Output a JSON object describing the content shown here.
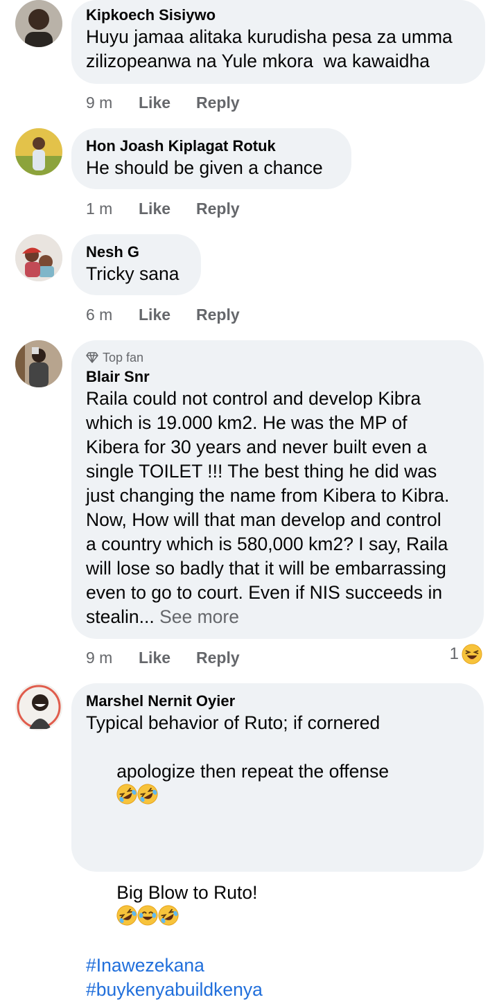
{
  "colors": {
    "bubble": "#eff2f5",
    "meta": "#65676b",
    "link": "#216fdb"
  },
  "comments": [
    {
      "name": "Kipkoech Sisiywo",
      "text_lines": [
        "Huyu jamaa alitaka kurudisha pesa za umma",
        "zilizopeanwa na Yule mkora  wa kawaidha"
      ],
      "time": "9 m",
      "like": "Like",
      "reply": "Reply"
    },
    {
      "name": "Hon Joash Kiplagat Rotuk",
      "text_lines": [
        "He should be given a chance"
      ],
      "time": "1 m",
      "like": "Like",
      "reply": "Reply"
    },
    {
      "name": "Nesh G",
      "text_lines": [
        "Tricky sana"
      ],
      "time": "6 m",
      "like": "Like",
      "reply": "Reply"
    },
    {
      "badge": "Top fan",
      "name": "Blair Snr",
      "text_lines": [
        "Raila could not control and develop Kibra",
        "which is 19.000 km2. He was the MP of",
        "Kibera for 30 years and never built even a",
        "single TOILET !!! The best thing he did was",
        "just changing the name from Kibera to Kibra.",
        "Now, How will that man develop and control",
        "a country which is 580,000 km2? I say, Raila",
        "will lose so badly that it will be embarrassing",
        "even to go to court. Even if NIS succeeds in",
        "stealin..."
      ],
      "see_more": "See more",
      "time": "9 m",
      "like": "Like",
      "reply": "Reply",
      "reaction_count": "1",
      "reaction_icon": "laughing-emoji-icon"
    },
    {
      "name": "Marshel Nernit Oyier",
      "text_line1": "Typical behavior of Ruto; if cornered",
      "text_line2": "apologize then repeat the offense",
      "text_line3": "Big Blow to Ruto!",
      "hashtags": [
        "#Inawezekana",
        "#buykenyabuildkenya"
      ]
    }
  ]
}
